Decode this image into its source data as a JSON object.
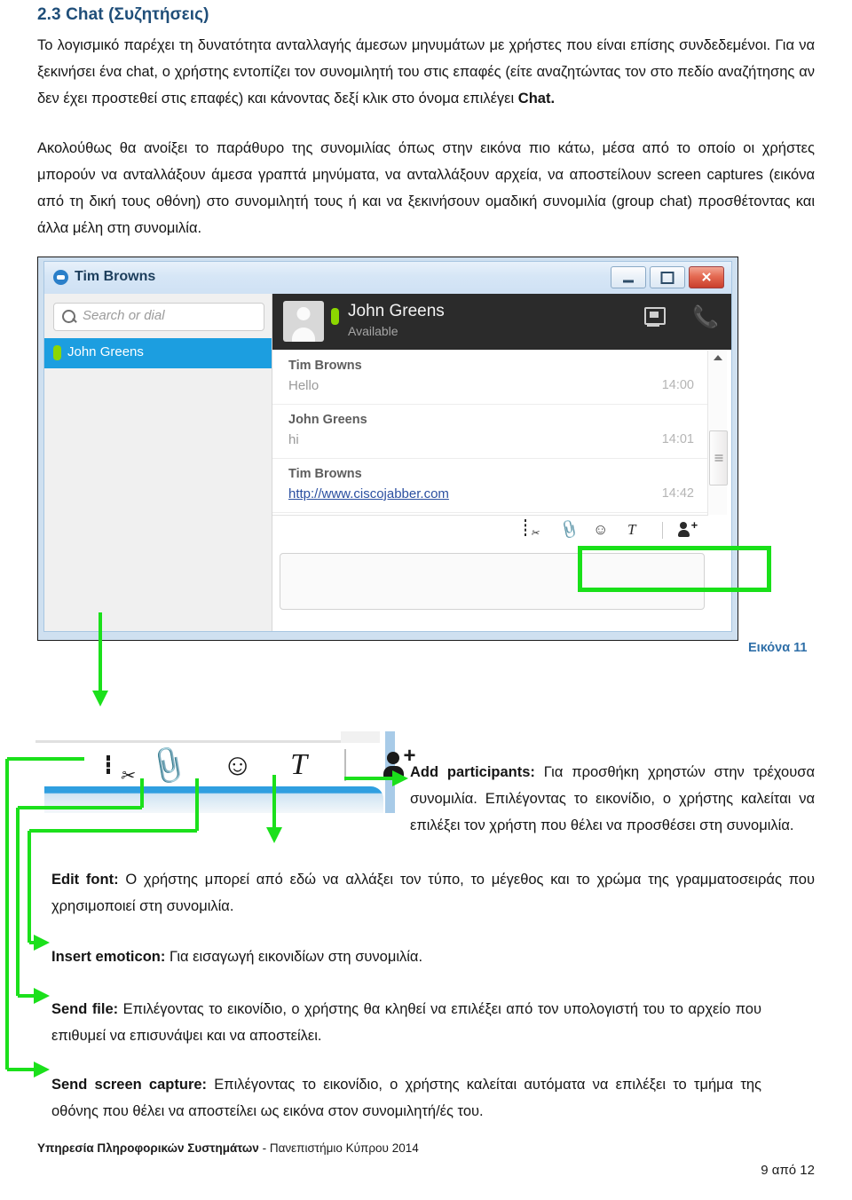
{
  "document": {
    "heading": "2.3 Chat (Συζητήσεις)",
    "paragraph1_a": "Το λογισμικό παρέχει τη δυνατότητα ανταλλαγής άμεσων μηνυμάτων με χρήστες που είναι επίσης συνδεδεμένοι. Για να ξεκινήσει ένα chat, ο χρήστης εντοπίζει τον συνομιλητή του στις επαφές (είτε αναζητώντας τον στο πεδίο αναζήτησης αν δεν έχει προστεθεί στις επαφές) και κάνοντας δεξί κλικ στο όνομα επιλέγει ",
    "paragraph1_bold": "Chat.",
    "paragraph2": "Ακολούθως θα ανοίξει το παράθυρο της συνομιλίας όπως στην εικόνα πιο κάτω, μέσα από το οποίο οι χρήστες μπορούν να ανταλλάξουν άμεσα γραπτά μηνύματα, να ανταλλάξουν αρχεία, να αποστείλουν screen captures (εικόνα από τη δική τους οθόνη) στο συνομιλητή τους ή και να ξεκινήσουν ομαδική συνομιλία (group chat) προσθέτοντας και άλλα μέλη στη συνομιλία.",
    "figure_caption": "Εικόνα 11",
    "footer_bold": "Υπηρεσία Πληροφορικών Συστημάτων",
    "footer_rest": " - Πανεπιστήμιο Κύπρου 2014",
    "page_number": "9 από 12"
  },
  "screenshot": {
    "window_title": "Tim Browns",
    "window_buttons": {
      "minimize": "minimize-icon",
      "maximize": "maximize-icon",
      "close": "✕"
    },
    "search": {
      "placeholder": "Search or dial",
      "icon": "search-icon"
    },
    "contacts": [
      {
        "name": "John Greens",
        "presence": "available",
        "presence_color": "#8cd600",
        "selected": true
      }
    ],
    "chat_header": {
      "name": "John Greens",
      "status": "Available",
      "presence_color": "#8cd600",
      "icons": [
        "share-screen-icon",
        "call-phone-icon"
      ]
    },
    "messages": [
      {
        "sender": "Tim Browns",
        "text": "Hello",
        "time": "14:00",
        "is_link": false
      },
      {
        "sender": "John Greens",
        "text": "hi",
        "time": "14:01",
        "is_link": false
      },
      {
        "sender": "Tim Browns",
        "text": "http://www.ciscojabber.com",
        "time": "14:42",
        "is_link": true
      }
    ],
    "compose_toolbar_icons": [
      "send-screen-capture-icon",
      "send-file-icon",
      "insert-emoticon-icon",
      "edit-font-icon",
      "add-participants-icon"
    ],
    "highlight_color": "#19e019",
    "accent_blue": "#1c9ee0"
  },
  "zoom_panel": {
    "icons": [
      "send-screen-capture-icon",
      "send-file-icon",
      "insert-emoticon-icon",
      "edit-font-icon",
      "add-participants-icon"
    ],
    "emoticon_glyph": "☺",
    "clip_glyph": "📎",
    "text_glyph": "T",
    "plus_glyph": "+"
  },
  "callouts": [
    {
      "id": "add-participants",
      "title": "Add participants:",
      "body": " Για προσθήκη χρηστών στην τρέχουσα συνομιλία. Επιλέγοντας το εικονίδιο, ο χρήστης καλείται να επιλέξει τον χρήστη που θέλει να προσθέσει στη συνομιλία."
    },
    {
      "id": "edit-font",
      "title": "Edit font:",
      "body": " Ο χρήστης μπορεί από εδώ να αλλάξει τον τύπο, το μέγεθος και το χρώμα της γραμματοσειράς που χρησιμοποιεί στη συνομιλία."
    },
    {
      "id": "insert-emoticon",
      "title": "Insert emoticon:",
      "body": " Για εισαγωγή εικονιδίων στη συνομιλία."
    },
    {
      "id": "send-file",
      "title": "Send file:",
      "body": " Επιλέγοντας το εικονίδιο, ο χρήστης θα κληθεί να επιλέξει από τον υπολογιστή του το αρχείο που επιθυμεί να επισυνάψει και να αποστείλει."
    },
    {
      "id": "send-screen-capture",
      "title": "Send screen capture:",
      "body": " Επιλέγοντας το εικονίδιο, ο χρήστης καλείται αυτόματα να επιλέξει το τμήμα της οθόνης που θέλει να αποστείλει ως εικόνα στον συνομιλητή/ές του."
    }
  ]
}
